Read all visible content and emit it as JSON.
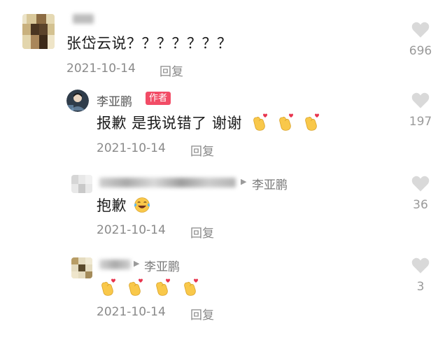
{
  "comments": [
    {
      "text": "张岱云说？？？？？？？",
      "date": "2021-10-14",
      "reply": "回复",
      "likes": "696"
    },
    {
      "author": "李亚鹏",
      "badge": "作者",
      "text": "报歉 是我说错了 谢谢",
      "emoji": [
        "heart-hands-icon",
        "heart-hands-icon",
        "heart-hands-icon"
      ],
      "date": "2021-10-14",
      "reply": "回复",
      "likes": "197"
    },
    {
      "reply_to": "李亚鹏",
      "text": "抱歉",
      "emoji": [
        "laughing-crying-icon"
      ],
      "date": "2021-10-14",
      "reply": "回复",
      "likes": "36"
    },
    {
      "reply_to": "李亚鹏",
      "emoji": [
        "heart-hands-icon",
        "heart-hands-icon",
        "heart-hands-icon",
        "heart-hands-icon"
      ],
      "date": "2021-10-14",
      "reply": "回复",
      "likes": "3"
    }
  ],
  "colors": {
    "badge": "#f24c66",
    "like_icon": "#d9d9d9",
    "meta": "#8a8a8a"
  }
}
